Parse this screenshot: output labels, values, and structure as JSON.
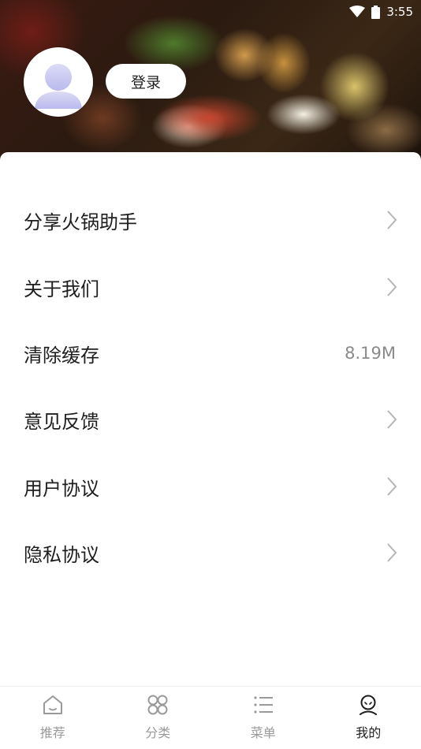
{
  "status_bar": {
    "time": "3:55",
    "icons": [
      "wifi-icon",
      "battery-icon"
    ]
  },
  "header": {
    "avatar_icon": "default-user-avatar",
    "login_label": "登录"
  },
  "menu": {
    "items": [
      {
        "label": "分享火锅助手",
        "value": "",
        "icon": "chevron-right-icon"
      },
      {
        "label": "关于我们",
        "value": "",
        "icon": "chevron-right-icon"
      },
      {
        "label": "清除缓存",
        "value": "8.19M",
        "icon": ""
      },
      {
        "label": "意见反馈",
        "value": "",
        "icon": "chevron-right-icon"
      },
      {
        "label": "用户协议",
        "value": "",
        "icon": "chevron-right-icon"
      },
      {
        "label": "隐私协议",
        "value": "",
        "icon": "chevron-right-icon"
      }
    ]
  },
  "tab_bar": {
    "tabs": [
      {
        "label": "推荐",
        "icon": "home-icon",
        "active": false
      },
      {
        "label": "分类",
        "icon": "grid-icon",
        "active": false
      },
      {
        "label": "菜单",
        "icon": "list-icon",
        "active": false
      },
      {
        "label": "我的",
        "icon": "profile-icon",
        "active": true
      }
    ]
  },
  "colors": {
    "text_primary": "#1e1e1e",
    "text_secondary": "#8a8a8a",
    "tab_inactive": "#9a9a9a",
    "background": "#ffffff"
  }
}
